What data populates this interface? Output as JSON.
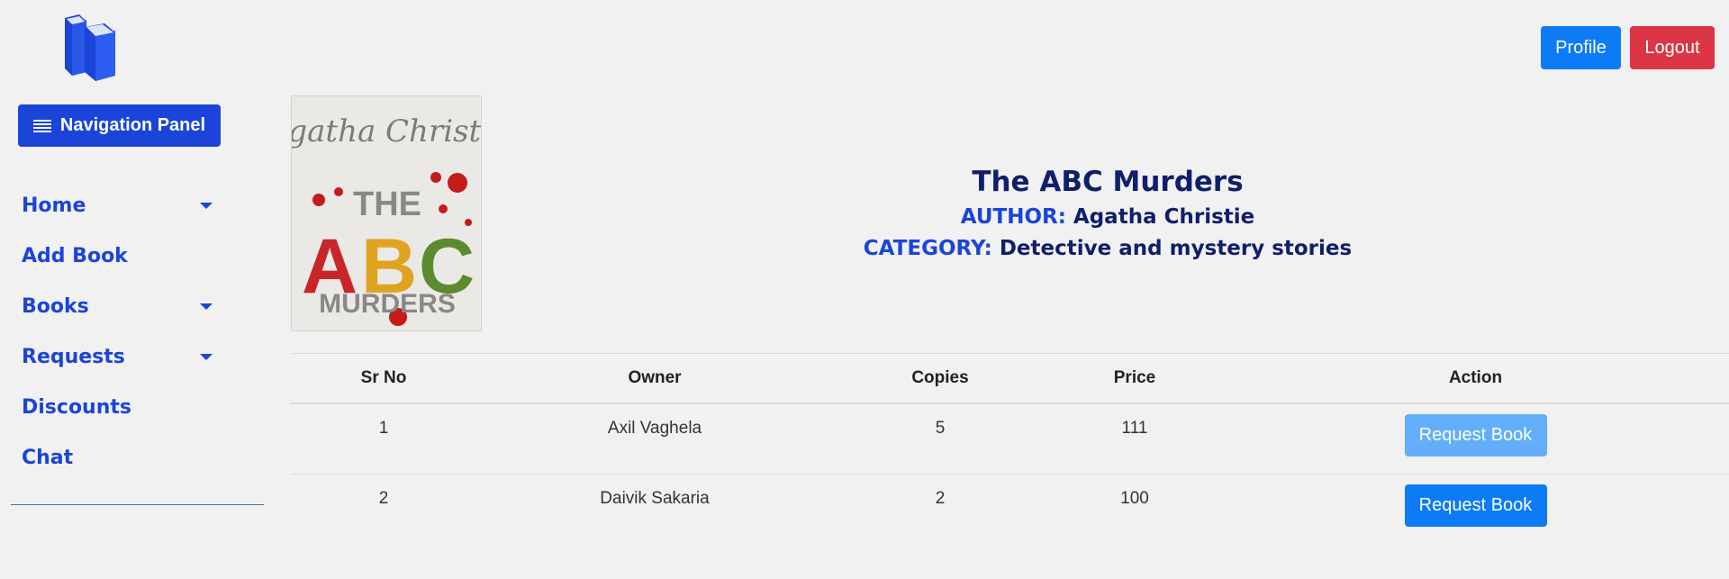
{
  "sidebar": {
    "logo_icon": "books-icon",
    "nav_button": {
      "icon": "hamburger-icon",
      "label": "Navigation Panel"
    },
    "items": [
      {
        "label": "Home",
        "has_dropdown": true
      },
      {
        "label": "Add Book",
        "has_dropdown": false
      },
      {
        "label": "Books",
        "has_dropdown": true
      },
      {
        "label": "Requests",
        "has_dropdown": true
      },
      {
        "label": "Discounts",
        "has_dropdown": false
      },
      {
        "label": "Chat",
        "has_dropdown": false
      }
    ]
  },
  "header": {
    "profile_label": "Profile",
    "logout_label": "Logout"
  },
  "book": {
    "cover_author_script": "Agatha Christie",
    "cover_title_line1": "THE",
    "cover_title_abc": [
      "A",
      "B",
      "C"
    ],
    "cover_title_line3": "MURDERS",
    "title": "The ABC Murders",
    "author_label": "AUTHOR:",
    "author": "Agatha Christie",
    "category_label": "CATEGORY:",
    "category": "Detective and mystery stories"
  },
  "table": {
    "headers": [
      "Sr No",
      "Owner",
      "Copies",
      "Price",
      "Action"
    ],
    "rows": [
      {
        "sr": "1",
        "owner": "Axil Vaghela",
        "copies": "5",
        "price": "111",
        "action": "Request Book",
        "disabled": true
      },
      {
        "sr": "2",
        "owner": "Daivik Sakaria",
        "copies": "2",
        "price": "100",
        "action": "Request Book",
        "disabled": false
      }
    ]
  },
  "colors": {
    "primary": "#1b45d8",
    "button_blue": "#0d7bf5",
    "button_blue_disabled": "#62aefa",
    "danger": "#dc3545",
    "title_navy": "#0f1f6b",
    "background": "#f2f1f1"
  }
}
